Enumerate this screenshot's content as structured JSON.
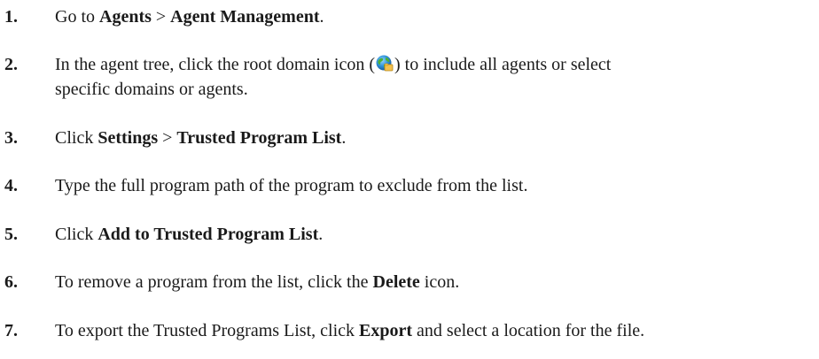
{
  "steps": [
    {
      "num": "1.",
      "parts": [
        "Go to ",
        "Agents",
        " > ",
        "Agent Management",
        "."
      ]
    },
    {
      "num": "2.",
      "line1_before": "In the agent tree, click the root domain icon (",
      "line1_after": ") to include all agents or select",
      "line2": "specific domains or agents.",
      "icon": "root-domain-globe-icon"
    },
    {
      "num": "3.",
      "parts": [
        "Click ",
        "Settings",
        " > ",
        "Trusted Program List",
        "."
      ]
    },
    {
      "num": "4.",
      "text": "Type the full program path of the program to exclude from the list."
    },
    {
      "num": "5.",
      "parts": [
        "Click ",
        "Add to Trusted Program List",
        "."
      ]
    },
    {
      "num": "6.",
      "parts": [
        "To remove a program from the list, click the ",
        "Delete",
        " icon."
      ]
    },
    {
      "num": "7.",
      "parts": [
        "To export the Trusted Programs List, click ",
        "Export",
        " and select a location for the file."
      ]
    }
  ]
}
